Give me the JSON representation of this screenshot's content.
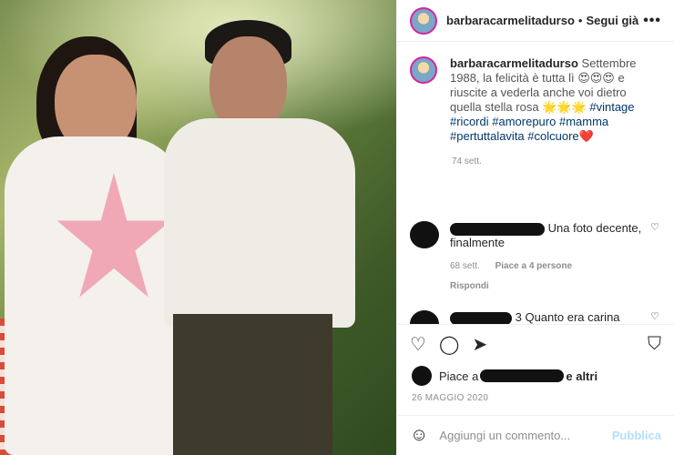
{
  "header": {
    "username": "barbaracarmelitadurso",
    "separator": "•",
    "follow_label": "Segui già",
    "more_label": "•••"
  },
  "caption": {
    "username": "barbaracarmelitadurso",
    "text": "Settembre 1988, la felicità è tutta lì 😍😍😍 e riuscite a vederla anche voi dietro quella stella rosa 🌟🌟🌟",
    "tags": [
      "#vintage",
      "#ricordi",
      "#amorepuro",
      "#mamma",
      "#pertuttalavita",
      "#colcuore"
    ],
    "heart": "❤️",
    "age": "74 sett."
  },
  "comments": [
    {
      "text": "Una foto decente, finalmente",
      "age": "68 sett.",
      "likes": "Piace a 4 persone",
      "reply": "Rispondi"
    },
    {
      "text": "3 Quanto era carina"
    }
  ],
  "likes_line": {
    "prefix": "Piace a",
    "suffix": "e altri"
  },
  "date": "26 MAGGIO 2020",
  "add_comment": {
    "placeholder": "Aggiungi un commento...",
    "publish": "Pubblica"
  },
  "icons": {
    "like": "heart-icon",
    "comment": "comment-icon",
    "share": "share-icon",
    "save": "bookmark-icon",
    "emoji": "emoji-icon",
    "comment_like": "small-heart-icon"
  }
}
